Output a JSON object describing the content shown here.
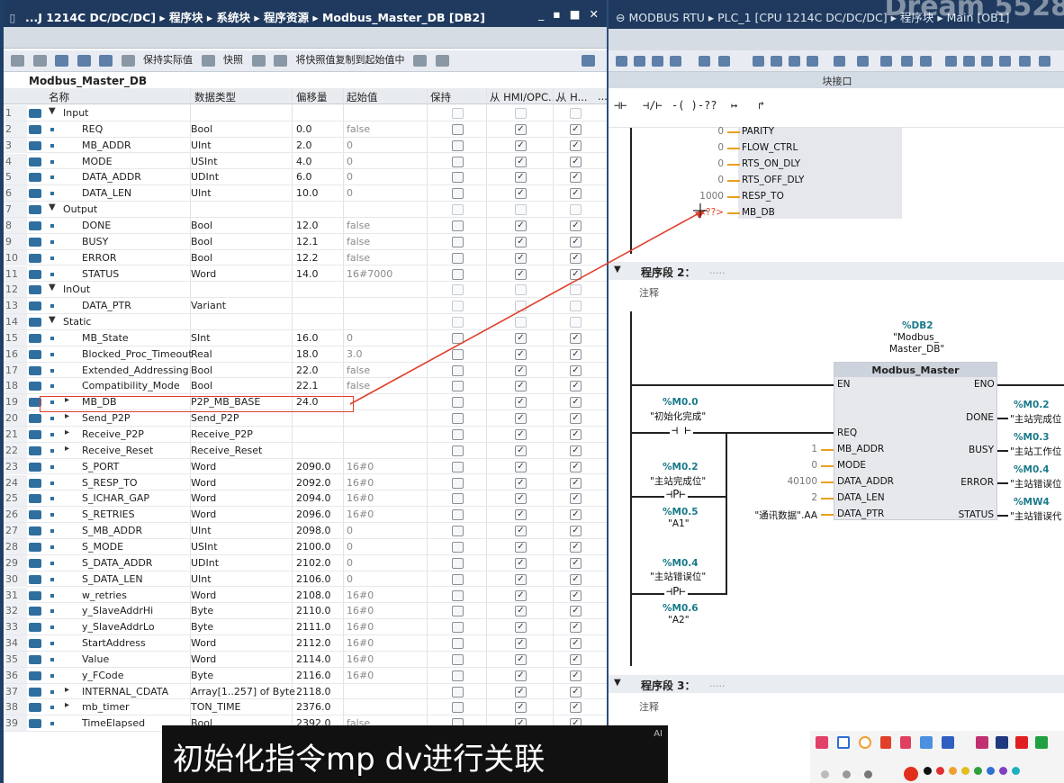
{
  "left_window": {
    "title": "...J 1214C DC/DC/DC] ▸ 程序块 ▸ 系统块 ▸ 程序资源 ▸ Modbus_Master_DB [DB2]",
    "controls": "_ ▪ ■ ✕",
    "toolbar": {
      "keep_actual": "保持实际值",
      "snapshot": "快照",
      "copy_snapshot": "将快照值复制到起始值中"
    },
    "db_name": "Modbus_Master_DB",
    "headers": {
      "name": "名称",
      "type": "数据类型",
      "offset": "偏移量",
      "start": "起始值",
      "retain": "保持",
      "hmi1": "从 HMI/OPC...",
      "hmi2": "从 H...",
      "more": "..."
    },
    "rows": [
      {
        "n": "1",
        "name": "Input",
        "type": "",
        "off": "",
        "init": "",
        "level": 0,
        "expand": "▼",
        "checks": [
          false,
          false,
          false
        ],
        "dim": true
      },
      {
        "n": "2",
        "name": "REQ",
        "type": "Bool",
        "off": "0.0",
        "init": "false",
        "level": 1,
        "expand": "",
        "checks": [
          false,
          true,
          true
        ],
        "dim": false
      },
      {
        "n": "3",
        "name": "MB_ADDR",
        "type": "UInt",
        "off": "2.0",
        "init": "0",
        "level": 1,
        "expand": "",
        "checks": [
          false,
          true,
          true
        ],
        "dim": false
      },
      {
        "n": "4",
        "name": "MODE",
        "type": "USInt",
        "off": "4.0",
        "init": "0",
        "level": 1,
        "expand": "",
        "checks": [
          false,
          true,
          true
        ],
        "dim": false
      },
      {
        "n": "5",
        "name": "DATA_ADDR",
        "type": "UDInt",
        "off": "6.0",
        "init": "0",
        "level": 1,
        "expand": "",
        "checks": [
          false,
          true,
          true
        ],
        "dim": false
      },
      {
        "n": "6",
        "name": "DATA_LEN",
        "type": "UInt",
        "off": "10.0",
        "init": "0",
        "level": 1,
        "expand": "",
        "checks": [
          false,
          true,
          true
        ],
        "dim": false
      },
      {
        "n": "7",
        "name": "Output",
        "type": "",
        "off": "",
        "init": "",
        "level": 0,
        "expand": "▼",
        "checks": [
          false,
          false,
          false
        ],
        "dim": true
      },
      {
        "n": "8",
        "name": "DONE",
        "type": "Bool",
        "off": "12.0",
        "init": "false",
        "level": 1,
        "expand": "",
        "checks": [
          false,
          true,
          true
        ],
        "dim": false
      },
      {
        "n": "9",
        "name": "BUSY",
        "type": "Bool",
        "off": "12.1",
        "init": "false",
        "level": 1,
        "expand": "",
        "checks": [
          false,
          true,
          true
        ],
        "dim": false
      },
      {
        "n": "10",
        "name": "ERROR",
        "type": "Bool",
        "off": "12.2",
        "init": "false",
        "level": 1,
        "expand": "",
        "checks": [
          false,
          true,
          true
        ],
        "dim": false
      },
      {
        "n": "11",
        "name": "STATUS",
        "type": "Word",
        "off": "14.0",
        "init": "16#7000",
        "level": 1,
        "expand": "",
        "checks": [
          false,
          true,
          true
        ],
        "dim": false
      },
      {
        "n": "12",
        "name": "InOut",
        "type": "",
        "off": "",
        "init": "",
        "level": 0,
        "expand": "▼",
        "checks": [
          false,
          false,
          false
        ],
        "dim": true
      },
      {
        "n": "13",
        "name": "DATA_PTR",
        "type": "Variant",
        "off": "",
        "init": "",
        "level": 1,
        "expand": "",
        "checks": [
          false,
          false,
          false
        ],
        "dim": true
      },
      {
        "n": "14",
        "name": "Static",
        "type": "",
        "off": "",
        "init": "",
        "level": 0,
        "expand": "▼",
        "checks": [
          false,
          false,
          false
        ],
        "dim": true
      },
      {
        "n": "15",
        "name": "MB_State",
        "type": "SInt",
        "off": "16.0",
        "init": "0",
        "level": 1,
        "expand": "",
        "checks": [
          false,
          true,
          true
        ],
        "dim": false
      },
      {
        "n": "16",
        "name": "Blocked_Proc_Timeout",
        "type": "Real",
        "off": "18.0",
        "init": "3.0",
        "level": 1,
        "expand": "",
        "checks": [
          false,
          true,
          true
        ],
        "dim": false
      },
      {
        "n": "17",
        "name": "Extended_Addressing",
        "type": "Bool",
        "off": "22.0",
        "init": "false",
        "level": 1,
        "expand": "",
        "checks": [
          false,
          true,
          true
        ],
        "dim": false
      },
      {
        "n": "18",
        "name": "Compatibility_Mode",
        "type": "Bool",
        "off": "22.1",
        "init": "false",
        "level": 1,
        "expand": "",
        "checks": [
          false,
          true,
          true
        ],
        "dim": false
      },
      {
        "n": "19",
        "name": "MB_DB",
        "type": "P2P_MB_BASE",
        "off": "24.0",
        "init": "",
        "level": 1,
        "expand": "▸",
        "checks": [
          false,
          true,
          true
        ],
        "dim": false
      },
      {
        "n": "20",
        "name": "Send_P2P",
        "type": "Send_P2P",
        "off": "",
        "init": "",
        "level": 1,
        "expand": "▸",
        "checks": [
          false,
          true,
          true
        ],
        "dim": false
      },
      {
        "n": "21",
        "name": "Receive_P2P",
        "type": "Receive_P2P",
        "off": "",
        "init": "",
        "level": 1,
        "expand": "▸",
        "checks": [
          false,
          true,
          true
        ],
        "dim": false
      },
      {
        "n": "22",
        "name": "Receive_Reset",
        "type": "Receive_Reset",
        "off": "",
        "init": "",
        "level": 1,
        "expand": "▸",
        "checks": [
          false,
          true,
          true
        ],
        "dim": false
      },
      {
        "n": "23",
        "name": "S_PORT",
        "type": "Word",
        "off": "2090.0",
        "init": "16#0",
        "level": 1,
        "expand": "",
        "checks": [
          false,
          true,
          true
        ],
        "dim": false
      },
      {
        "n": "24",
        "name": "S_RESP_TO",
        "type": "Word",
        "off": "2092.0",
        "init": "16#0",
        "level": 1,
        "expand": "",
        "checks": [
          false,
          true,
          true
        ],
        "dim": false
      },
      {
        "n": "25",
        "name": "S_ICHAR_GAP",
        "type": "Word",
        "off": "2094.0",
        "init": "16#0",
        "level": 1,
        "expand": "",
        "checks": [
          false,
          true,
          true
        ],
        "dim": false
      },
      {
        "n": "26",
        "name": "S_RETRIES",
        "type": "Word",
        "off": "2096.0",
        "init": "16#0",
        "level": 1,
        "expand": "",
        "checks": [
          false,
          true,
          true
        ],
        "dim": false
      },
      {
        "n": "27",
        "name": "S_MB_ADDR",
        "type": "UInt",
        "off": "2098.0",
        "init": "0",
        "level": 1,
        "expand": "",
        "checks": [
          false,
          true,
          true
        ],
        "dim": false
      },
      {
        "n": "28",
        "name": "S_MODE",
        "type": "USInt",
        "off": "2100.0",
        "init": "0",
        "level": 1,
        "expand": "",
        "checks": [
          false,
          true,
          true
        ],
        "dim": false
      },
      {
        "n": "29",
        "name": "S_DATA_ADDR",
        "type": "UDInt",
        "off": "2102.0",
        "init": "0",
        "level": 1,
        "expand": "",
        "checks": [
          false,
          true,
          true
        ],
        "dim": false
      },
      {
        "n": "30",
        "name": "S_DATA_LEN",
        "type": "UInt",
        "off": "2106.0",
        "init": "0",
        "level": 1,
        "expand": "",
        "checks": [
          false,
          true,
          true
        ],
        "dim": false
      },
      {
        "n": "31",
        "name": "w_retries",
        "type": "Word",
        "off": "2108.0",
        "init": "16#0",
        "level": 1,
        "expand": "",
        "checks": [
          false,
          true,
          true
        ],
        "dim": false
      },
      {
        "n": "32",
        "name": "y_SlaveAddrHi",
        "type": "Byte",
        "off": "2110.0",
        "init": "16#0",
        "level": 1,
        "expand": "",
        "checks": [
          false,
          true,
          true
        ],
        "dim": false
      },
      {
        "n": "33",
        "name": "y_SlaveAddrLo",
        "type": "Byte",
        "off": "2111.0",
        "init": "16#0",
        "level": 1,
        "expand": "",
        "checks": [
          false,
          true,
          true
        ],
        "dim": false
      },
      {
        "n": "34",
        "name": "StartAddress",
        "type": "Word",
        "off": "2112.0",
        "init": "16#0",
        "level": 1,
        "expand": "",
        "checks": [
          false,
          true,
          true
        ],
        "dim": false
      },
      {
        "n": "35",
        "name": "Value",
        "type": "Word",
        "off": "2114.0",
        "init": "16#0",
        "level": 1,
        "expand": "",
        "checks": [
          false,
          true,
          true
        ],
        "dim": false
      },
      {
        "n": "36",
        "name": "y_FCode",
        "type": "Byte",
        "off": "2116.0",
        "init": "16#0",
        "level": 1,
        "expand": "",
        "checks": [
          false,
          true,
          true
        ],
        "dim": false
      },
      {
        "n": "37",
        "name": "INTERNAL_CDATA",
        "type": "Array[1..257] of Byte",
        "off": "2118.0",
        "init": "",
        "level": 1,
        "expand": "▸",
        "checks": [
          false,
          true,
          true
        ],
        "dim": false
      },
      {
        "n": "38",
        "name": "mb_timer",
        "type": "TON_TIME",
        "off": "2376.0",
        "init": "",
        "level": 1,
        "expand": "▸",
        "checks": [
          false,
          true,
          true
        ],
        "dim": false
      },
      {
        "n": "39",
        "name": "TimeElapsed",
        "type": "Bool",
        "off": "2392.0",
        "init": "false",
        "level": 1,
        "expand": "",
        "checks": [
          false,
          true,
          true
        ],
        "dim": false
      }
    ]
  },
  "right_window": {
    "title": "MODBUS RTU ▸ PLC_1 [CPU 1214C DC/DC/DC] ▸ 程序块 ▸ Main [OB1]",
    "watermark": "Dream 5528",
    "interface_label": "块接口",
    "ladder_buttons": [
      "⊣⊢",
      "⊣/⊢",
      "-( )-",
      "??",
      "↦",
      "↱"
    ],
    "top_block_pins": [
      {
        "val": "0",
        "name": "PARITY"
      },
      {
        "val": "0",
        "name": "FLOW_CTRL"
      },
      {
        "val": "0",
        "name": "RTS_ON_DLY"
      },
      {
        "val": "0",
        "name": "RTS_OFF_DLY"
      },
      {
        "val": "1000",
        "name": "RESP_TO"
      },
      {
        "val": "<??>",
        "name": "MB_DB"
      }
    ],
    "segment2": {
      "title": "程序段 2：",
      "dots": ".....",
      "comment": "注释",
      "instance_addr": "%DB2",
      "instance_name_1": "\"Modbus_",
      "instance_name_2": "Master_DB\"",
      "block_name": "Modbus_Master",
      "en": "EN",
      "eno": "ENO",
      "inputs": [
        {
          "val": "",
          "name": "REQ"
        },
        {
          "val": "1",
          "name": "MB_ADDR"
        },
        {
          "val": "0",
          "name": "MODE"
        },
        {
          "val": "40100",
          "name": "DATA_ADDR"
        },
        {
          "val": "2",
          "name": "DATA_LEN"
        },
        {
          "val": "\"通讯数据\".AA",
          "name": "DATA_PTR"
        }
      ],
      "outputs": [
        {
          "name": "DONE",
          "addr": "%M0.2",
          "tag": "\"主站完成位"
        },
        {
          "name": "BUSY",
          "addr": "%M0.3",
          "tag": "\"主站工作位"
        },
        {
          "name": "ERROR",
          "addr": "%M0.4",
          "tag": "\"主站错误位"
        },
        {
          "name": "STATUS",
          "addr": "%MW4",
          "tag": "\"主站错误代"
        }
      ],
      "contacts": [
        {
          "addr": "%M0.0",
          "tag": "\"初始化完成\"",
          "symbol": "⊣ ⊢"
        },
        {
          "addr": "%M0.2",
          "tag": "\"主站完成位\"",
          "symbol": "⊣P⊢",
          "sub_addr": "%M0.5",
          "sub_tag": "\"A1\""
        },
        {
          "addr": "%M0.4",
          "tag": "\"主站错误位\"",
          "symbol": "⊣P⊢",
          "sub_addr": "%M0.6",
          "sub_tag": "\"A2\""
        }
      ]
    },
    "segment3": {
      "title": "程序段 3：",
      "dots": ".....",
      "comment": "注释"
    }
  },
  "subtitle": "初始化指令mp dv进行关联",
  "ai_badge": "AI",
  "colors": {
    "title_bar": "#1f3a5e",
    "highlight_box": "#e0402c",
    "pin_wire": "#e8a020",
    "tag_address": "#1a7a8a"
  }
}
